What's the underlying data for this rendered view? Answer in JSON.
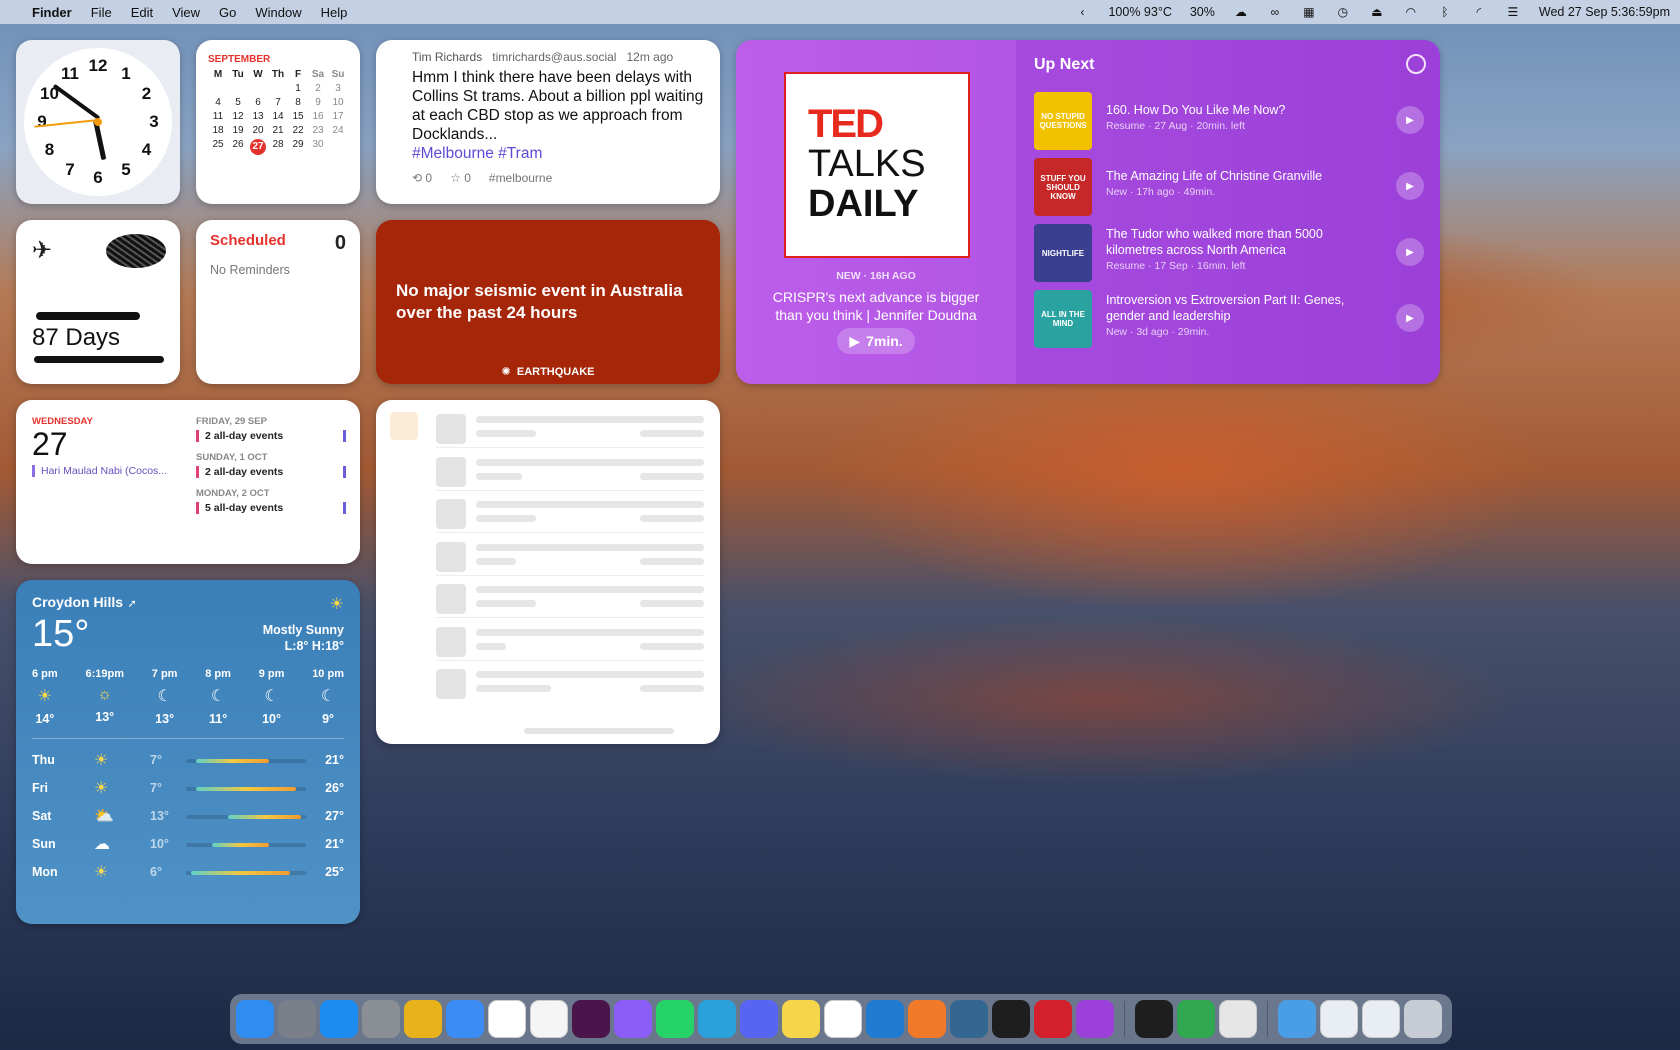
{
  "menubar": {
    "app": "Finder",
    "menus": [
      "File",
      "Edit",
      "View",
      "Go",
      "Window",
      "Help"
    ],
    "battery_text": "100% 93°C",
    "cpu_text": "30%",
    "datetime": "Wed 27 Sep  5:36:59pm"
  },
  "clock": {
    "numbers": [
      "12",
      "1",
      "2",
      "3",
      "4",
      "5",
      "6",
      "7",
      "8",
      "9",
      "10",
      "11"
    ]
  },
  "calendar_month": {
    "month": "SEPTEMBER",
    "headers": [
      "M",
      "Tu",
      "W",
      "Th",
      "F",
      "Sa",
      "Su"
    ],
    "days": [
      "",
      "",
      "",
      "",
      "1",
      "2",
      "3",
      "4",
      "5",
      "6",
      "7",
      "8",
      "9",
      "10",
      "11",
      "12",
      "13",
      "14",
      "15",
      "16",
      "17",
      "18",
      "19",
      "20",
      "21",
      "22",
      "23",
      "24",
      "25",
      "26",
      "27",
      "28",
      "29",
      "30",
      ""
    ],
    "today": "27"
  },
  "toot": {
    "author": "Tim Richards",
    "handle": "timrichards@aus.social",
    "time": "12m ago",
    "body": "Hmm I think there have been delays with Collins St trams. About a billion ppl waiting at each CBD stop as we approach from Docklands...",
    "tags": "#Melbourne #Tram",
    "boosts": "0",
    "favs": "0",
    "tag_footer": "#melbourne"
  },
  "flight": {
    "days": "87 Days"
  },
  "reminders": {
    "title": "Scheduled",
    "count": "0",
    "empty": "No Reminders"
  },
  "quake": {
    "message": "No major seismic event in Australia over the past 24 hours",
    "label": "EARTHQUAKE"
  },
  "podcast": {
    "art_line1": "TED",
    "art_line2": "TALKS",
    "art_line3": "DAILY",
    "badge": "NEW · 16H AGO",
    "episode": "CRISPR's next advance is bigger than you think | Jennifer Doudna",
    "duration": "7min.",
    "up_next_title": "Up Next",
    "items": [
      {
        "title": "160. How Do You Like Me Now?",
        "meta": "Resume · 27 Aug · 20min. left",
        "art_text": "NO STUPID QUESTIONS",
        "art_color": "#f2c200"
      },
      {
        "title": "The Amazing Life of Christine Granville",
        "meta": "New · 17h ago · 49min.",
        "art_text": "STUFF YOU SHOULD KNOW",
        "art_color": "#c62828"
      },
      {
        "title": "The Tudor who walked more than 5000 kilometres across North America",
        "meta": "Resume · 17 Sep · 16min. left",
        "art_text": "NIGHTLIFE",
        "art_color": "#3a3f8f"
      },
      {
        "title": "Introversion vs Extroversion Part II: Genes, gender and leadership",
        "meta": "New · 3d ago · 29min.",
        "art_text": "ALL IN THE MIND",
        "art_color": "#2aa3a0"
      }
    ]
  },
  "calendar_events": {
    "weekday": "WEDNESDAY",
    "day": "27",
    "today_event": "Hari Maulad Nabi (Cocos...",
    "upcoming": [
      {
        "date": "FRIDAY, 29 SEP",
        "events": "2 all-day events"
      },
      {
        "date": "SUNDAY, 1 OCT",
        "events": "2 all-day events"
      },
      {
        "date": "MONDAY, 2 OCT",
        "events": "5 all-day events"
      }
    ]
  },
  "weather": {
    "location": "Croydon Hills",
    "temp": "15°",
    "condition": "Mostly Sunny",
    "range": "L:8° H:18°",
    "hourly": [
      {
        "time": "6 pm",
        "temp": "14°",
        "icon": "sun-icon"
      },
      {
        "time": "6:19pm",
        "temp": "13°",
        "icon": "sunset-icon"
      },
      {
        "time": "7 pm",
        "temp": "13°",
        "icon": "moon-icon"
      },
      {
        "time": "8 pm",
        "temp": "11°",
        "icon": "moon-icon"
      },
      {
        "time": "9 pm",
        "temp": "10°",
        "icon": "moon-icon"
      },
      {
        "time": "10 pm",
        "temp": "9°",
        "icon": "moon-icon"
      }
    ],
    "daily": [
      {
        "day": "Thu",
        "low": "7°",
        "high": "21°",
        "icon": "sun-icon"
      },
      {
        "day": "Fri",
        "low": "7°",
        "high": "26°",
        "icon": "sun-icon"
      },
      {
        "day": "Sat",
        "low": "13°",
        "high": "27°",
        "icon": "partly-cloudy-icon"
      },
      {
        "day": "Sun",
        "low": "10°",
        "high": "21°",
        "icon": "cloud-icon"
      },
      {
        "day": "Mon",
        "low": "6°",
        "high": "25°",
        "icon": "sun-icon"
      }
    ]
  },
  "colors": {
    "accent_red": "#e5322d",
    "podcast_purple": "#a64adf",
    "quake_red": "#a52608",
    "weather_blue": "#3a7fb8"
  },
  "dock": {
    "apps": [
      {
        "name": "finder",
        "color": "#2f8cf0"
      },
      {
        "name": "launchpad",
        "color": "#7a7f8a"
      },
      {
        "name": "app-store",
        "color": "#1c8cf2"
      },
      {
        "name": "system-settings",
        "color": "#8a8f96"
      },
      {
        "name": "chrome",
        "color": "#e8b21a"
      },
      {
        "name": "mail",
        "color": "#3b8cf5"
      },
      {
        "name": "calendar",
        "color": "#ffffff"
      },
      {
        "name": "reminders",
        "color": "#f5f5f5"
      },
      {
        "name": "slack",
        "color": "#4a154b"
      },
      {
        "name": "messenger",
        "color": "#8b5cf6"
      },
      {
        "name": "whatsapp",
        "color": "#25d366"
      },
      {
        "name": "telegram",
        "color": "#2aa1da"
      },
      {
        "name": "discord",
        "color": "#5865f2"
      },
      {
        "name": "notes",
        "color": "#f7d54a"
      },
      {
        "name": "notion",
        "color": "#ffffff"
      },
      {
        "name": "vscode",
        "color": "#1f7ad1"
      },
      {
        "name": "sketch-tool",
        "color": "#f07a2a"
      },
      {
        "name": "postgres",
        "color": "#336791"
      },
      {
        "name": "terminal",
        "color": "#1e1e1e"
      },
      {
        "name": "acrobat",
        "color": "#d3202a"
      },
      {
        "name": "podcasts",
        "color": "#9b40d8"
      },
      {
        "name": "activity-monitor",
        "color": "#1e1e1e"
      },
      {
        "name": "vpn",
        "color": "#2fa84f"
      },
      {
        "name": "next-arrow",
        "color": "#e6e6e6"
      },
      {
        "name": "downloads",
        "color": "#4a9ee6"
      },
      {
        "name": "window-1",
        "color": "#e9eef5"
      },
      {
        "name": "window-2",
        "color": "#e9eef5"
      },
      {
        "name": "trash",
        "color": "#c7ccd4"
      }
    ]
  }
}
